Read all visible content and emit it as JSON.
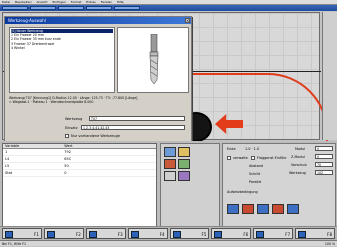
{
  "menubar": {
    "items": [
      "Datei",
      "Bearbeiten",
      "Ansicht",
      "Einfügen",
      "Format",
      "Extras",
      "Fenster",
      "Hilfe"
    ]
  },
  "dialog": {
    "title": "Werkzeug-Auswahl",
    "list": [
      "[S] Neuer Werkzeug",
      "1 Ein Fraeser 20 mm",
      "2 Ein Fraeser 35 mm kurz ende",
      "3 Fraeser 37 Drenkenfraser",
      "4 Winkel"
    ],
    "info_line1": "Werkzeug T07 [Kennung1]   D-Radius 12.00 · Länge: 125.73 · T3: -77.800 [Länge]",
    "info_line2": "= Wegabst.1 · Plateau 1 · Wendeschneidplatte 8.000",
    "werkzeug_label": "Werkzeug",
    "werkzeug_value": "T07",
    "einsatz_label": "Einsatz",
    "einsatz_value": "1,2,3,4,41,42,43",
    "opt_nur_vorhandene": "Nur vorhandene Werkzeuge",
    "opt_erkennung": "Erkennung/Kennzeichnung anzeigen",
    "btn_ok": "OK",
    "btn_cancel": "Abbruch",
    "btn_help": "Hilfe"
  },
  "table": {
    "headers": [
      "Variable",
      "Wert"
    ],
    "rows": [
      {
        "var": "1",
        "val": "792"
      },
      {
        "var": "L4",
        "val": "65C"
      },
      {
        "var": "L5",
        "val": "50"
      },
      {
        "var": "Stat",
        "val": "0"
      }
    ]
  },
  "controls": {
    "ende_label": "Ende",
    "ende_val": "1.0 · 1.0",
    "modul_label": "Modul",
    "modul_val": "0",
    "zmodul_label": "Z-Modul",
    "zmodul_val": "0",
    "verwalten": "verwalte",
    "flaggen": "Flaggenst Einführ",
    "abstand": "Abstand",
    "schritt": "Schritt",
    "parallel": "Parallel",
    "vorschub_label": "Vorschub",
    "vorschub_val": "70",
    "werkzeug_label": "Werkzeug",
    "werkzeug_val": "102",
    "aufsetz": "Aufsetzbedingung"
  },
  "fkeys": [
    "F1",
    "F2",
    "F3",
    "F4",
    "F5",
    "F6",
    "F7",
    "F8"
  ],
  "status": {
    "left": "Bei F1, Hilfe F1",
    "right": "100 %"
  }
}
